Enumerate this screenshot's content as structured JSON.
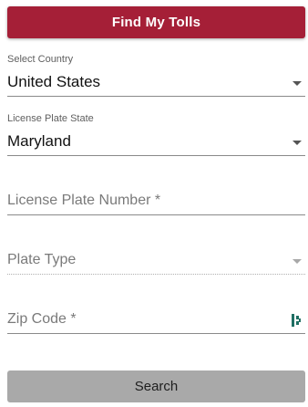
{
  "header": {
    "find_tolls_label": "Find My Tolls"
  },
  "country": {
    "label": "Select Country",
    "value": "United States"
  },
  "plate_state": {
    "label": "License Plate State",
    "value": "Maryland"
  },
  "plate_number": {
    "placeholder": "License Plate Number *"
  },
  "plate_type": {
    "placeholder": "Plate Type"
  },
  "zip_code": {
    "placeholder": "Zip Code *",
    "icon": "password-manager-icon"
  },
  "actions": {
    "search_label": "Search"
  },
  "colors": {
    "primary": "#a51f37",
    "search_button": "#a9a9a9",
    "icon_accent": "#1f6f63"
  }
}
